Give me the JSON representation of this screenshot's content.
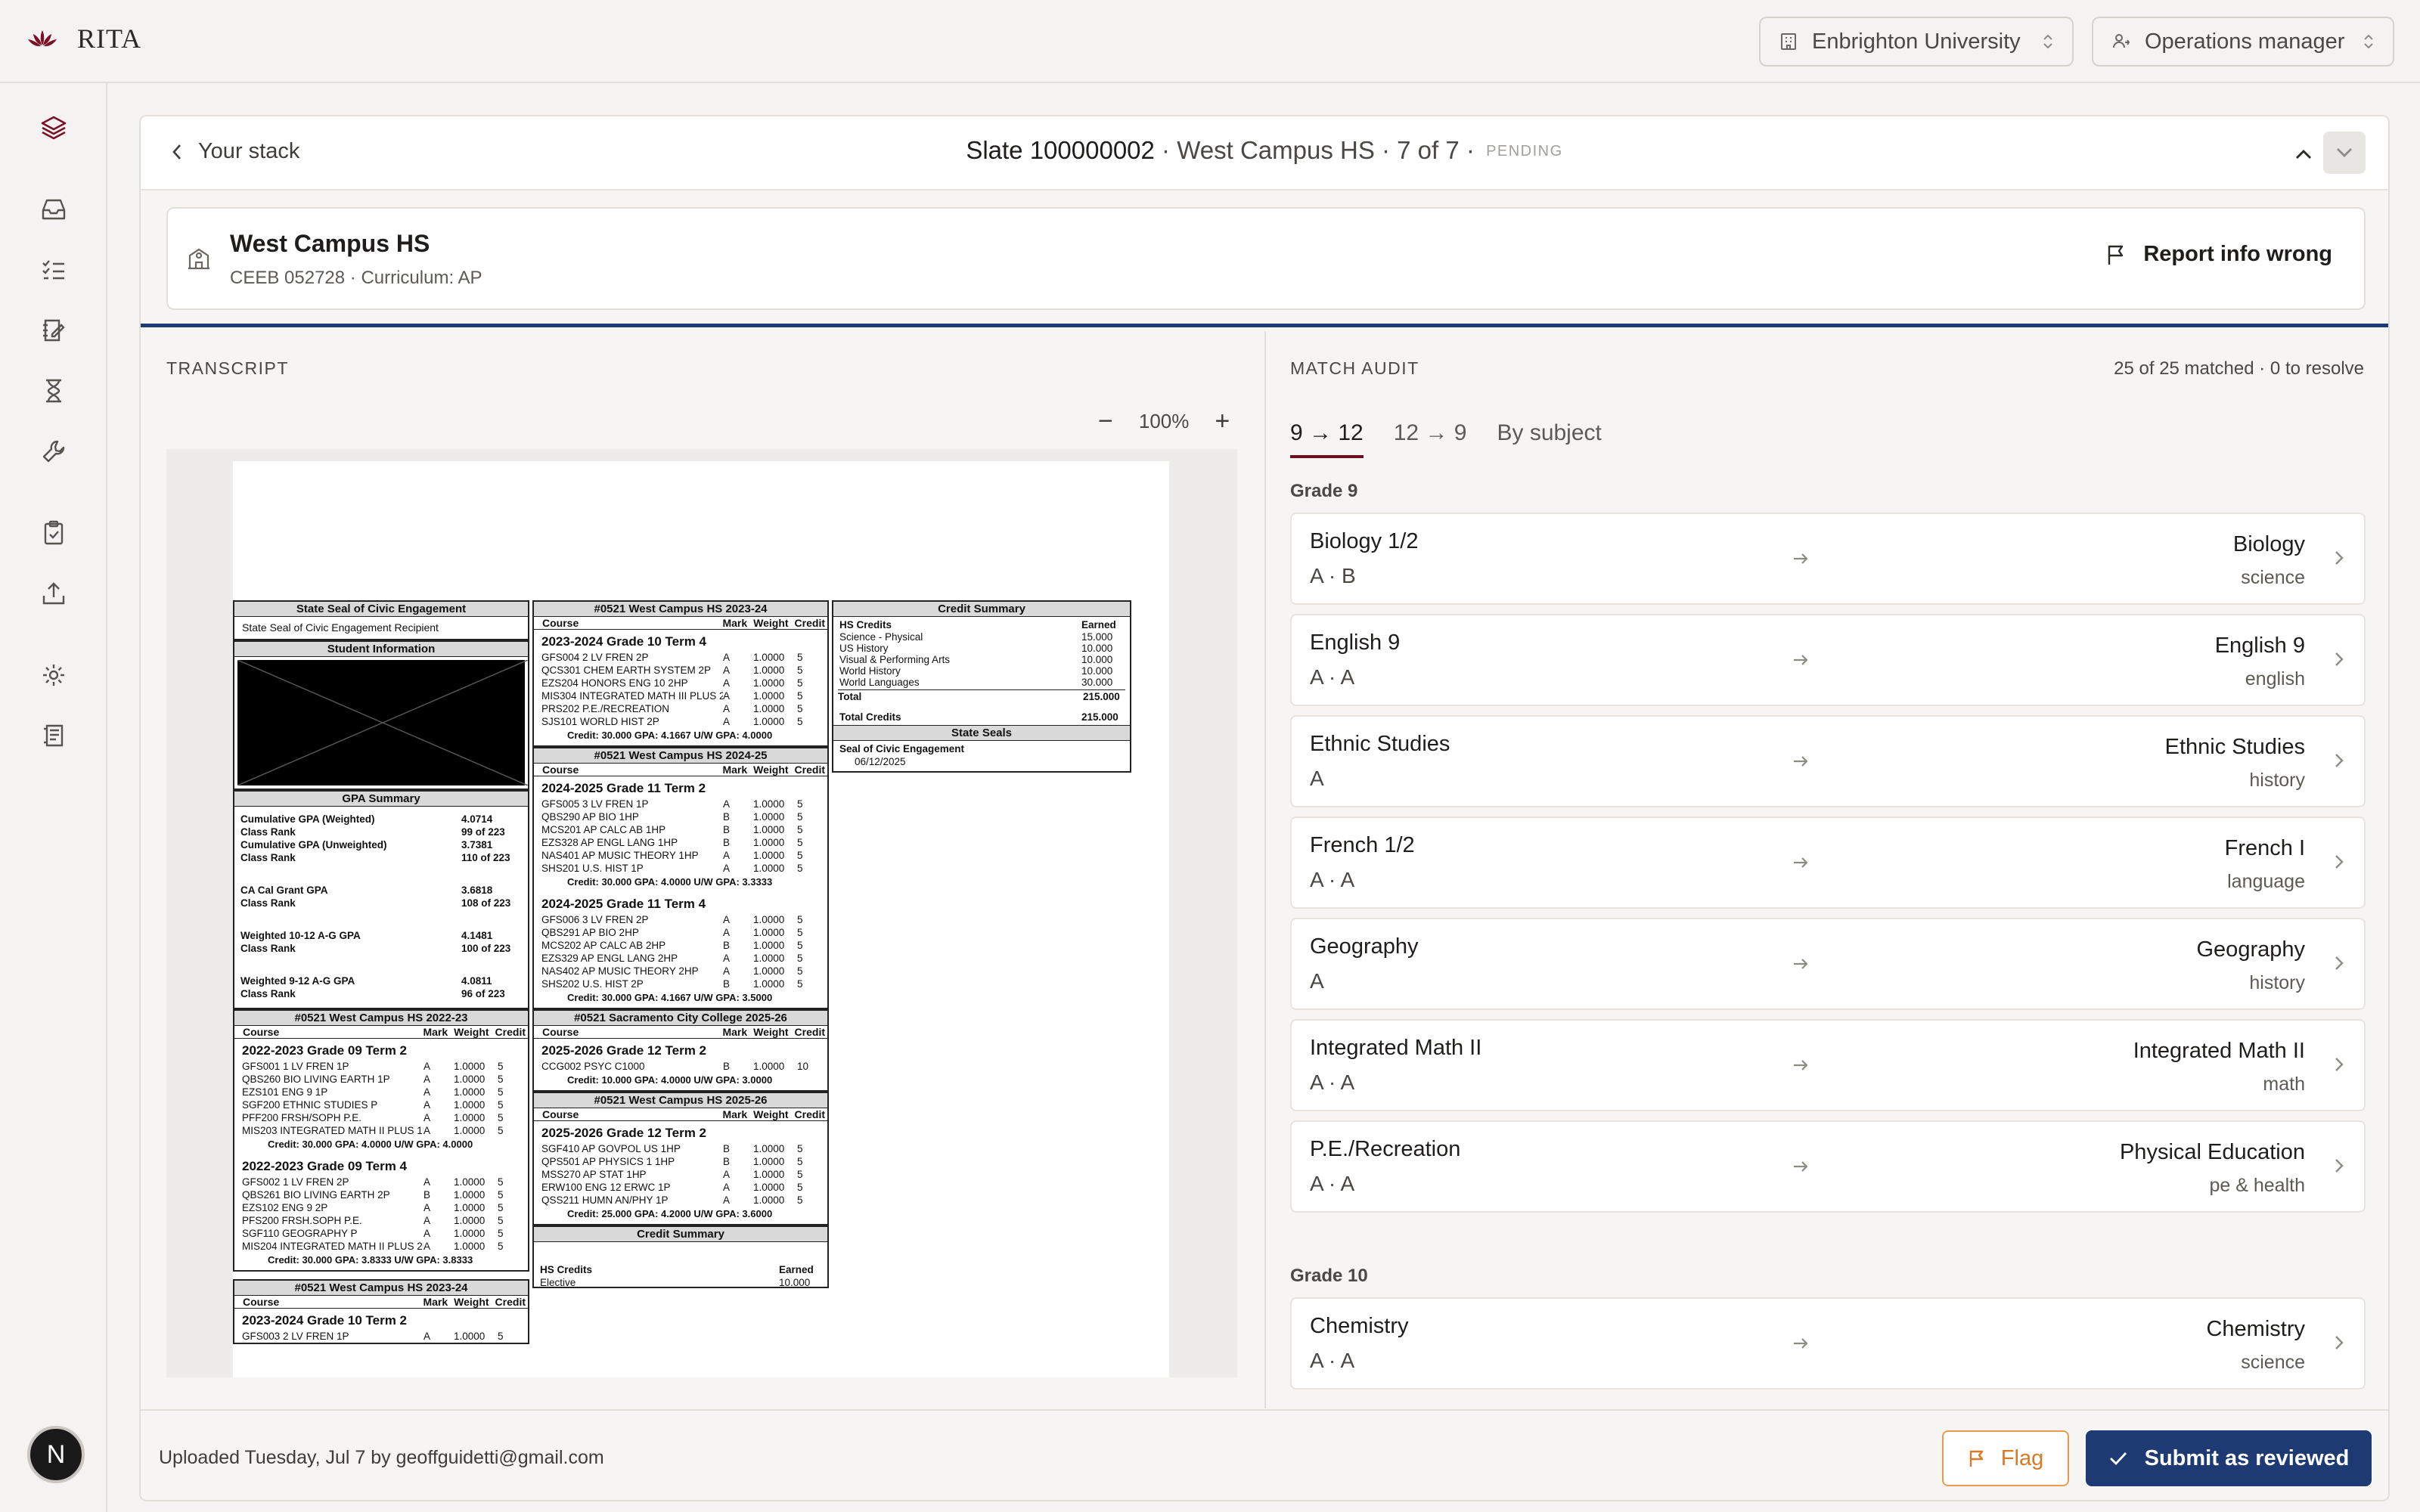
{
  "app": {
    "name": "RITA"
  },
  "header": {
    "institution": "Enbrighton University",
    "role": "Operations manager"
  },
  "slate": {
    "back_label": "Your stack",
    "title": "Slate 100000002",
    "subtitle": "· West Campus HS · 7 of 7 ·",
    "status": "PENDING"
  },
  "school": {
    "name": "West Campus HS",
    "details": "CEEB 052728 · Curriculum: AP",
    "report_label": "Report info wrong"
  },
  "transcript": {
    "label": "TRANSCRIPT",
    "zoom": "100%",
    "doc": {
      "seal_header": "State Seal of Civic Engagement",
      "seal_text": "State Seal of Civic Engagement Recipient",
      "student_info_header": "Student Information",
      "gpa_header": "GPA Summary",
      "gpa": [
        {
          "k": "Cumulative GPA (Weighted)",
          "v": "4.0714"
        },
        {
          "k": "Class Rank",
          "v": "99 of 223"
        },
        {
          "k": "Cumulative GPA (Unweighted)",
          "v": "3.7381"
        },
        {
          "k": "Class Rank",
          "v": "110 of 223"
        },
        {
          "k": "CA Cal Grant GPA",
          "v": "3.6818"
        },
        {
          "k": "Class Rank",
          "v": "108 of 223"
        },
        {
          "k": "Weighted 10-12 A-G GPA",
          "v": "4.1481"
        },
        {
          "k": "Class Rank",
          "v": "100 of 223"
        },
        {
          "k": "Weighted 9-12 A-G GPA",
          "v": "4.0811"
        },
        {
          "k": "Class Rank",
          "v": "96 of 223"
        }
      ],
      "col_course": "Course",
      "col_mark": "Mark",
      "col_weight": "Weight",
      "col_credit": "Credit",
      "h2022": "#0521 West Campus HS 2022-23",
      "t2022a": "2022-2023 Grade 09   Term 2",
      "r2022a": [
        [
          "GFS001 1 LV FREN 1P",
          "A",
          "1.0000",
          "5"
        ],
        [
          "QBS260 BIO LIVING EARTH 1P",
          "A",
          "1.0000",
          "5"
        ],
        [
          "EZS101 ENG 9 1P",
          "A",
          "1.0000",
          "5"
        ],
        [
          "SGF200 ETHNIC STUDIES P",
          "A",
          "1.0000",
          "5"
        ],
        [
          "PFF200 FRSH/SOPH P.E.",
          "A",
          "1.0000",
          "5"
        ],
        [
          "MIS203 INTEGRATED MATH II PLUS 1P",
          "A",
          "1.0000",
          "5"
        ]
      ],
      "s2022a": "Credit: 30.000  GPA: 4.0000  U/W GPA: 4.0000",
      "t2022b": "2022-2023 Grade 09   Term 4",
      "r2022b": [
        [
          "GFS002 1 LV FREN 2P",
          "A",
          "1.0000",
          "5"
        ],
        [
          "QBS261 BIO LIVING EARTH 2P",
          "B",
          "1.0000",
          "5"
        ],
        [
          "EZS102 ENG 9 2P",
          "A",
          "1.0000",
          "5"
        ],
        [
          "PFS200 FRSH.SOPH P.E.",
          "A",
          "1.0000",
          "5"
        ],
        [
          "SGF110 GEOGRAPHY P",
          "A",
          "1.0000",
          "5"
        ],
        [
          "MIS204 INTEGRATED MATH II PLUS 2P",
          "A",
          "1.0000",
          "5"
        ]
      ],
      "s2022b": "Credit: 30.000  GPA: 3.8333  U/W GPA: 3.8333",
      "h2023": "#0521 West Campus HS 2023-24",
      "t2023a": "2023-2024 Grade 10   Term 2",
      "r2023a_partial": [
        [
          "GFS003 2 LV FREN 1P",
          "A",
          "1.0000",
          "5"
        ]
      ],
      "t2023b": "2023-2024 Grade 10   Term 4",
      "r2023b": [
        [
          "GFS004 2 LV FREN 2P",
          "A",
          "1.0000",
          "5"
        ],
        [
          "QCS301 CHEM EARTH SYSTEM 2P",
          "A",
          "1.0000",
          "5"
        ],
        [
          "EZS204 HONORS ENG 10 2HP",
          "A",
          "1.0000",
          "5"
        ],
        [
          "MIS304 INTEGRATED MATH III PLUS 2P",
          "A",
          "1.0000",
          "5"
        ],
        [
          "PRS202 P.E./RECREATION",
          "A",
          "1.0000",
          "5"
        ],
        [
          "SJS101 WORLD HIST 2P",
          "A",
          "1.0000",
          "5"
        ]
      ],
      "s2023b": "Credit: 30.000  GPA: 4.1667  U/W GPA: 4.0000",
      "h2024": "#0521 West Campus HS 2024-25",
      "t2024a": "2024-2025 Grade 11   Term 2",
      "r2024a": [
        [
          "GFS005 3 LV FREN 1P",
          "A",
          "1.0000",
          "5"
        ],
        [
          "QBS290 AP BIO 1HP",
          "B",
          "1.0000",
          "5"
        ],
        [
          "MCS201 AP CALC AB 1HP",
          "B",
          "1.0000",
          "5"
        ],
        [
          "EZS328 AP ENGL LANG 1HP",
          "B",
          "1.0000",
          "5"
        ],
        [
          "NAS401 AP MUSIC THEORY 1HP",
          "A",
          "1.0000",
          "5"
        ],
        [
          "SHS201 U.S. HIST 1P",
          "A",
          "1.0000",
          "5"
        ]
      ],
      "s2024a": "Credit: 30.000  GPA: 4.0000  U/W GPA: 3.3333",
      "t2024b": "2024-2025 Grade 11   Term 4",
      "r2024b": [
        [
          "GFS006 3 LV FREN 2P",
          "A",
          "1.0000",
          "5"
        ],
        [
          "QBS291 AP BIO 2HP",
          "A",
          "1.0000",
          "5"
        ],
        [
          "MCS202 AP CALC AB 2HP",
          "B",
          "1.0000",
          "5"
        ],
        [
          "EZS329 AP ENGL LANG 2HP",
          "A",
          "1.0000",
          "5"
        ],
        [
          "NAS402 AP MUSIC THEORY 2HP",
          "A",
          "1.0000",
          "5"
        ],
        [
          "SHS202 U.S. HIST 2P",
          "B",
          "1.0000",
          "5"
        ]
      ],
      "s2024b": "Credit: 30.000  GPA: 4.1667  U/W GPA: 3.5000",
      "hsac": "#0521 Sacramento City College 2025-26",
      "tsac": "2025-2026 Grade 12   Term 2",
      "rsac": [
        [
          "CCG002 PSYC C1000",
          "B",
          "1.0000",
          "10"
        ]
      ],
      "ssac": "Credit: 10.000  GPA: 4.0000  U/W GPA: 3.0000",
      "h2025": "#0521 West Campus HS 2025-26",
      "t2025": "2025-2026 Grade 12   Term 2",
      "r2025": [
        [
          "SGF410 AP GOVPOL US 1HP",
          "B",
          "1.0000",
          "5"
        ],
        [
          "QPS501 AP PHYSICS 1 1HP",
          "B",
          "1.0000",
          "5"
        ],
        [
          "MSS270 AP STAT 1HP",
          "A",
          "1.0000",
          "5"
        ],
        [
          "ERW100 ENG 12 ERWC 1P",
          "A",
          "1.0000",
          "5"
        ],
        [
          "QSS211 HUMN AN/PHY 1P",
          "A",
          "1.0000",
          "5"
        ]
      ],
      "s2025": "Credit: 25.000  GPA: 4.2000  U/W GPA: 3.6000",
      "credit_summary": "Credit Summary",
      "hs_credits": "HS Credits",
      "earned": "Earned",
      "credits": [
        {
          "k": "Science - Physical",
          "v": "15.000"
        },
        {
          "k": "US History",
          "v": "10.000"
        },
        {
          "k": "Visual & Performing Arts",
          "v": "10.000"
        },
        {
          "k": "World History",
          "v": "10.000"
        },
        {
          "k": "World Languages",
          "v": "30.000"
        }
      ],
      "total_label": "Total",
      "total_value": "215.000",
      "total_credits_label": "Total Credits",
      "total_credits_value": "215.000",
      "state_seals": "State Seals",
      "seal_name": "Seal of Civic Engagement",
      "seal_date": "06/12/2025",
      "partial_earned_value": "10.000",
      "partial_elective": "Elective"
    }
  },
  "audit": {
    "label": "MATCH AUDIT",
    "summary": "25 of 25 matched · 0 to resolve",
    "tabs": [
      "9 → 12",
      "12 → 9",
      "By subject"
    ],
    "grades": [
      {
        "label": "Grade 9",
        "items": [
          {
            "course": "Biology 1/2",
            "marks": "A · B",
            "match": "Biology",
            "category": "science"
          },
          {
            "course": "English 9",
            "marks": "A · A",
            "match": "English 9",
            "category": "english"
          },
          {
            "course": "Ethnic Studies",
            "marks": "A",
            "match": "Ethnic Studies",
            "category": "history"
          },
          {
            "course": "French 1/2",
            "marks": "A · A",
            "match": "French I",
            "category": "language"
          },
          {
            "course": "Geography",
            "marks": "A",
            "match": "Geography",
            "category": "history"
          },
          {
            "course": "Integrated Math II",
            "marks": "A · A",
            "match": "Integrated Math II",
            "category": "math"
          },
          {
            "course": "P.E./Recreation",
            "marks": "A · A",
            "match": "Physical Education",
            "category": "pe & health"
          }
        ]
      },
      {
        "label": "Grade 10",
        "items": [
          {
            "course": "Chemistry",
            "marks": "A · A",
            "match": "Chemistry",
            "category": "science"
          }
        ]
      }
    ]
  },
  "footer": {
    "uploaded": "Uploaded Tuesday, Jul 7 by geoffguidetti@gmail.com",
    "flag_label": "Flag",
    "submit_label": "Submit as reviewed"
  },
  "user": {
    "initial": "N"
  },
  "colors": {
    "navy": "#1e3a73",
    "accent": "#6b1023",
    "flag": "#d97a26"
  }
}
